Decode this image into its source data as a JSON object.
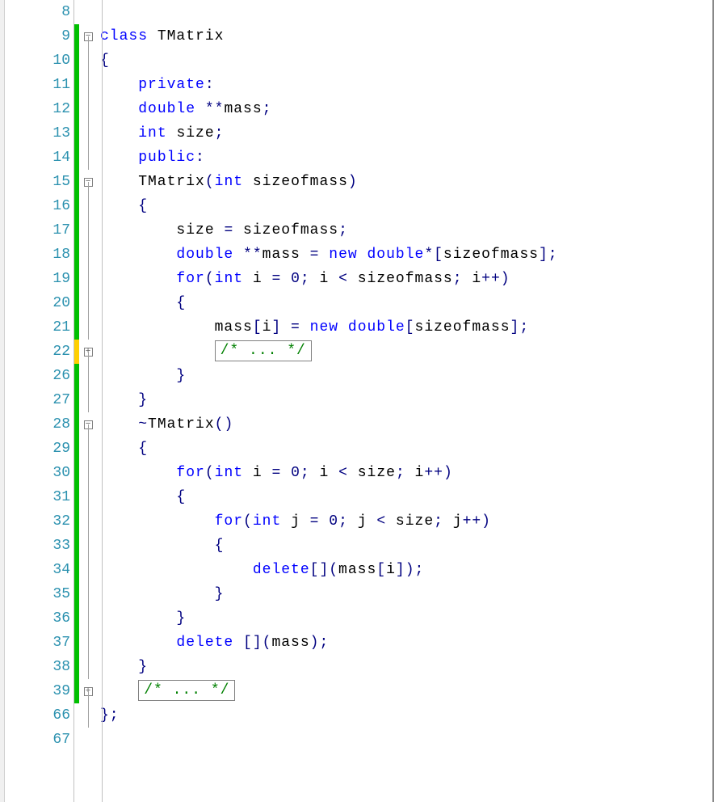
{
  "fold": {
    "minus": "−",
    "plus": "+"
  },
  "lines": [
    {
      "num": "8",
      "change": "",
      "fold": "",
      "tokens": []
    },
    {
      "num": "9",
      "change": "saved",
      "fold": "minus",
      "tokens": [
        {
          "t": "class ",
          "c": "kw"
        },
        {
          "t": "TMatrix",
          "c": ""
        }
      ]
    },
    {
      "num": "10",
      "change": "saved",
      "fold": "line",
      "tokens": [
        {
          "t": "{",
          "c": "op"
        }
      ]
    },
    {
      "num": "11",
      "change": "saved",
      "fold": "line",
      "tokens": [
        {
          "t": "    ",
          "c": ""
        },
        {
          "t": "private",
          "c": "kw"
        },
        {
          "t": ":",
          "c": "op"
        }
      ]
    },
    {
      "num": "12",
      "change": "saved",
      "fold": "line",
      "tokens": [
        {
          "t": "    ",
          "c": ""
        },
        {
          "t": "double ",
          "c": "kw"
        },
        {
          "t": "**",
          "c": "op"
        },
        {
          "t": "mass",
          "c": ""
        },
        {
          "t": ";",
          "c": "op"
        }
      ]
    },
    {
      "num": "13",
      "change": "saved",
      "fold": "line",
      "tokens": [
        {
          "t": "    ",
          "c": ""
        },
        {
          "t": "int ",
          "c": "kw"
        },
        {
          "t": "size",
          "c": ""
        },
        {
          "t": ";",
          "c": "op"
        }
      ]
    },
    {
      "num": "14",
      "change": "saved",
      "fold": "line",
      "tokens": [
        {
          "t": "    ",
          "c": ""
        },
        {
          "t": "public",
          "c": "kw"
        },
        {
          "t": ":",
          "c": "op"
        }
      ]
    },
    {
      "num": "15",
      "change": "saved",
      "fold": "minus",
      "tokens": [
        {
          "t": "    TMatrix",
          "c": ""
        },
        {
          "t": "(",
          "c": "op"
        },
        {
          "t": "int ",
          "c": "kw"
        },
        {
          "t": "sizeofmass",
          "c": ""
        },
        {
          "t": ")",
          "c": "op"
        }
      ]
    },
    {
      "num": "16",
      "change": "saved",
      "fold": "line",
      "tokens": [
        {
          "t": "    ",
          "c": ""
        },
        {
          "t": "{",
          "c": "op"
        }
      ]
    },
    {
      "num": "17",
      "change": "saved",
      "fold": "line",
      "tokens": [
        {
          "t": "        size ",
          "c": ""
        },
        {
          "t": "= ",
          "c": "op"
        },
        {
          "t": "sizeofmass",
          "c": ""
        },
        {
          "t": ";",
          "c": "op"
        }
      ]
    },
    {
      "num": "18",
      "change": "saved",
      "fold": "line",
      "tokens": [
        {
          "t": "        ",
          "c": ""
        },
        {
          "t": "double ",
          "c": "kw"
        },
        {
          "t": "**",
          "c": "op"
        },
        {
          "t": "mass ",
          "c": ""
        },
        {
          "t": "= ",
          "c": "op"
        },
        {
          "t": "new ",
          "c": "kw"
        },
        {
          "t": "double",
          "c": "kw"
        },
        {
          "t": "*[",
          "c": "op"
        },
        {
          "t": "sizeofmass",
          "c": ""
        },
        {
          "t": "];",
          "c": "op"
        }
      ]
    },
    {
      "num": "19",
      "change": "saved",
      "fold": "line",
      "tokens": [
        {
          "t": "        ",
          "c": ""
        },
        {
          "t": "for",
          "c": "kw"
        },
        {
          "t": "(",
          "c": "op"
        },
        {
          "t": "int ",
          "c": "kw"
        },
        {
          "t": "i ",
          "c": ""
        },
        {
          "t": "= ",
          "c": "op"
        },
        {
          "t": "0",
          "c": "op"
        },
        {
          "t": "; ",
          "c": "op"
        },
        {
          "t": "i ",
          "c": ""
        },
        {
          "t": "< ",
          "c": "op"
        },
        {
          "t": "sizeofmass",
          "c": ""
        },
        {
          "t": "; ",
          "c": "op"
        },
        {
          "t": "i",
          "c": ""
        },
        {
          "t": "++)",
          "c": "op"
        }
      ]
    },
    {
      "num": "20",
      "change": "saved",
      "fold": "line",
      "tokens": [
        {
          "t": "        ",
          "c": ""
        },
        {
          "t": "{",
          "c": "op"
        }
      ]
    },
    {
      "num": "21",
      "change": "saved",
      "fold": "line",
      "tokens": [
        {
          "t": "            mass",
          "c": ""
        },
        {
          "t": "[",
          "c": "op"
        },
        {
          "t": "i",
          "c": ""
        },
        {
          "t": "] = ",
          "c": "op"
        },
        {
          "t": "new ",
          "c": "kw"
        },
        {
          "t": "double",
          "c": "kw"
        },
        {
          "t": "[",
          "c": "op"
        },
        {
          "t": "sizeofmass",
          "c": ""
        },
        {
          "t": "];",
          "c": "op"
        }
      ]
    },
    {
      "num": "22",
      "change": "unsaved",
      "fold": "plus",
      "tokens": [
        {
          "t": "            ",
          "c": ""
        },
        {
          "box": "/* ... */"
        }
      ]
    },
    {
      "num": "26",
      "change": "saved",
      "fold": "line",
      "tokens": [
        {
          "t": "        ",
          "c": ""
        },
        {
          "t": "}",
          "c": "op"
        }
      ]
    },
    {
      "num": "27",
      "change": "saved",
      "fold": "line",
      "tokens": [
        {
          "t": "    ",
          "c": ""
        },
        {
          "t": "}",
          "c": "op"
        }
      ]
    },
    {
      "num": "28",
      "change": "saved",
      "fold": "minus",
      "tokens": [
        {
          "t": "    ",
          "c": ""
        },
        {
          "t": "~",
          "c": "op"
        },
        {
          "t": "TMatrix",
          "c": ""
        },
        {
          "t": "()",
          "c": "op"
        }
      ]
    },
    {
      "num": "29",
      "change": "saved",
      "fold": "line",
      "tokens": [
        {
          "t": "    ",
          "c": ""
        },
        {
          "t": "{",
          "c": "op"
        }
      ]
    },
    {
      "num": "30",
      "change": "saved",
      "fold": "line",
      "tokens": [
        {
          "t": "        ",
          "c": ""
        },
        {
          "t": "for",
          "c": "kw"
        },
        {
          "t": "(",
          "c": "op"
        },
        {
          "t": "int ",
          "c": "kw"
        },
        {
          "t": "i ",
          "c": ""
        },
        {
          "t": "= ",
          "c": "op"
        },
        {
          "t": "0",
          "c": "op"
        },
        {
          "t": "; ",
          "c": "op"
        },
        {
          "t": "i ",
          "c": ""
        },
        {
          "t": "< ",
          "c": "op"
        },
        {
          "t": "size",
          "c": ""
        },
        {
          "t": "; ",
          "c": "op"
        },
        {
          "t": "i",
          "c": ""
        },
        {
          "t": "++)",
          "c": "op"
        }
      ]
    },
    {
      "num": "31",
      "change": "saved",
      "fold": "line",
      "tokens": [
        {
          "t": "        ",
          "c": ""
        },
        {
          "t": "{",
          "c": "op"
        }
      ]
    },
    {
      "num": "32",
      "change": "saved",
      "fold": "line",
      "tokens": [
        {
          "t": "            ",
          "c": ""
        },
        {
          "t": "for",
          "c": "kw"
        },
        {
          "t": "(",
          "c": "op"
        },
        {
          "t": "int ",
          "c": "kw"
        },
        {
          "t": "j ",
          "c": ""
        },
        {
          "t": "= ",
          "c": "op"
        },
        {
          "t": "0",
          "c": "op"
        },
        {
          "t": "; ",
          "c": "op"
        },
        {
          "t": "j ",
          "c": ""
        },
        {
          "t": "< ",
          "c": "op"
        },
        {
          "t": "size",
          "c": ""
        },
        {
          "t": "; ",
          "c": "op"
        },
        {
          "t": "j",
          "c": ""
        },
        {
          "t": "++)",
          "c": "op"
        }
      ]
    },
    {
      "num": "33",
      "change": "saved",
      "fold": "line",
      "tokens": [
        {
          "t": "            ",
          "c": ""
        },
        {
          "t": "{",
          "c": "op"
        }
      ]
    },
    {
      "num": "34",
      "change": "saved",
      "fold": "line",
      "tokens": [
        {
          "t": "                ",
          "c": ""
        },
        {
          "t": "delete",
          "c": "kw"
        },
        {
          "t": "[](",
          "c": "op"
        },
        {
          "t": "mass",
          "c": ""
        },
        {
          "t": "[",
          "c": "op"
        },
        {
          "t": "i",
          "c": ""
        },
        {
          "t": "]);",
          "c": "op"
        }
      ]
    },
    {
      "num": "35",
      "change": "saved",
      "fold": "line",
      "tokens": [
        {
          "t": "            ",
          "c": ""
        },
        {
          "t": "}",
          "c": "op"
        }
      ]
    },
    {
      "num": "36",
      "change": "saved",
      "fold": "line",
      "tokens": [
        {
          "t": "        ",
          "c": ""
        },
        {
          "t": "}",
          "c": "op"
        }
      ]
    },
    {
      "num": "37",
      "change": "saved",
      "fold": "line",
      "tokens": [
        {
          "t": "        ",
          "c": ""
        },
        {
          "t": "delete ",
          "c": "kw"
        },
        {
          "t": "[](",
          "c": "op"
        },
        {
          "t": "mass",
          "c": ""
        },
        {
          "t": ");",
          "c": "op"
        }
      ]
    },
    {
      "num": "38",
      "change": "saved",
      "fold": "line",
      "tokens": [
        {
          "t": "    ",
          "c": ""
        },
        {
          "t": "}",
          "c": "op"
        }
      ]
    },
    {
      "num": "39",
      "change": "saved",
      "fold": "plus",
      "tokens": [
        {
          "t": "    ",
          "c": ""
        },
        {
          "box": "/* ... */"
        }
      ]
    },
    {
      "num": "66",
      "change": "",
      "fold": "line",
      "tokens": [
        {
          "t": "};",
          "c": "op"
        }
      ]
    },
    {
      "num": "67",
      "change": "",
      "fold": "",
      "tokens": []
    }
  ]
}
